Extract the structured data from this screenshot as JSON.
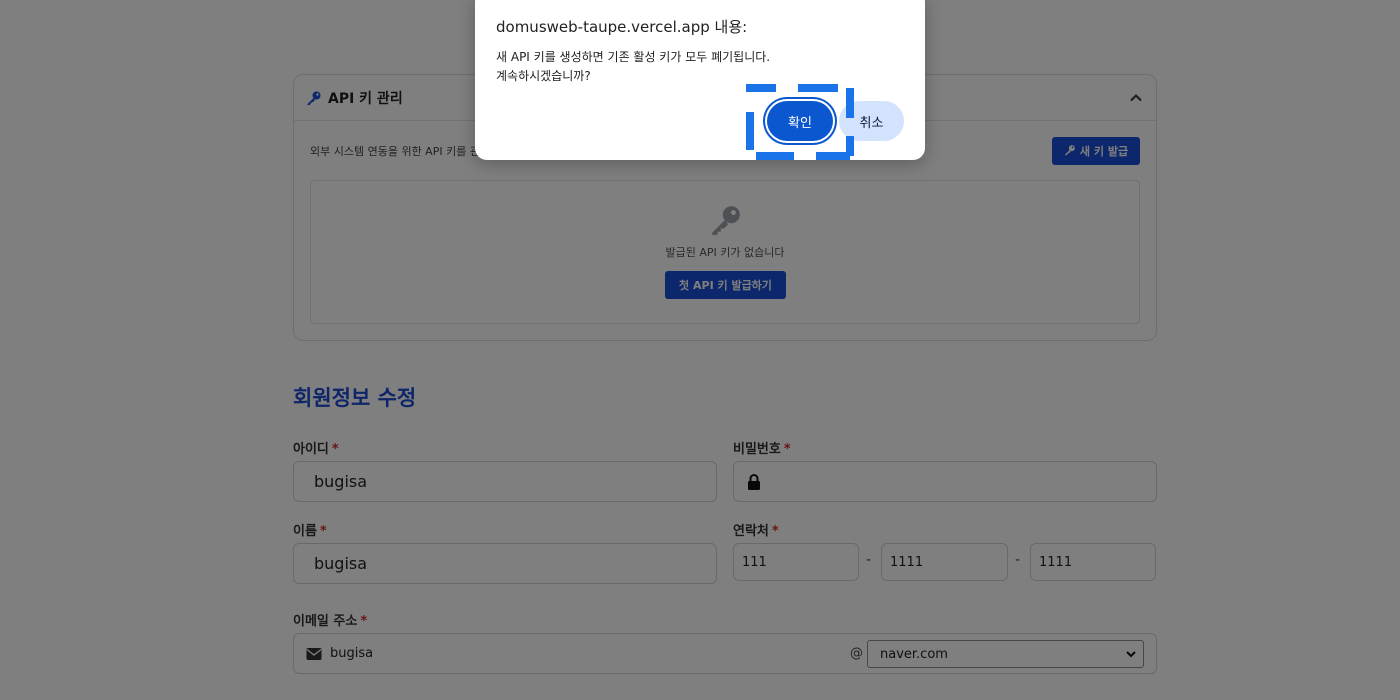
{
  "api_card": {
    "title": "API 키 관리",
    "description": "외부 시스템 연동을 위한 API 키를 관",
    "new_key_label": "새 키 발급",
    "empty_text": "발급된 API 키가 없습니다",
    "first_key_label": "첫 API 키 발급하기"
  },
  "member": {
    "section_title": "회원정보 수정",
    "id_label": "아이디",
    "id_value": "bugisa",
    "password_label": "비밀번호",
    "name_label": "이름",
    "name_value": "bugisa",
    "phone_label": "연락처",
    "phone_1": "111",
    "phone_2": "1111",
    "phone_3": "1111",
    "phone_sep": "-",
    "email_label": "이메일 주소",
    "email_local": "bugisa",
    "email_at": "@",
    "email_domain": "naver.com",
    "required_mark": "*"
  },
  "dialog": {
    "title": "domusweb-taupe.vercel.app 내용:",
    "message": "새 API 키를 생성하면 기존 활성 키가 모두 폐기됩니다.\n계속하시겠습니까?",
    "ok_label": "확인",
    "cancel_label": "취소"
  },
  "colors": {
    "primary": "#1b4fd8",
    "dialog_ok": "#0b57d0",
    "dialog_cancel": "#d3e3fd",
    "required": "#d6262b",
    "focus_marker": "#1a73e8"
  }
}
